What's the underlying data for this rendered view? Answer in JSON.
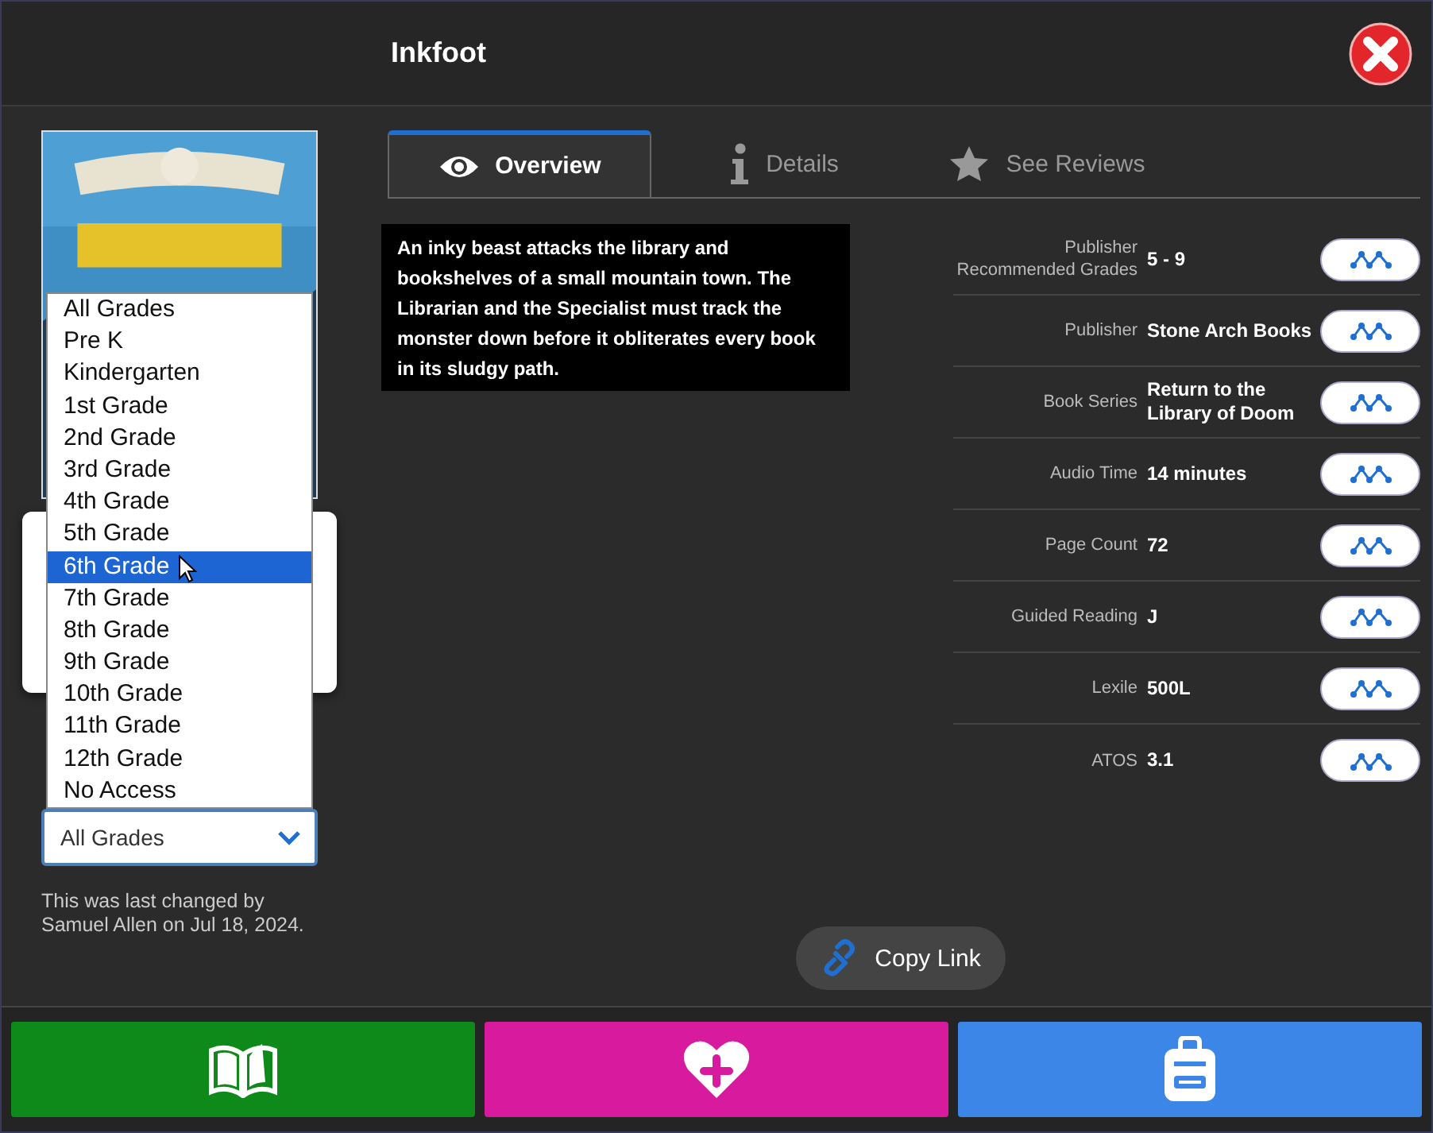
{
  "window": {
    "title": "Inkfoot"
  },
  "grade_dropdown": {
    "value": "All Grades",
    "options": [
      {
        "label": "All Grades",
        "highlighted": false
      },
      {
        "label": "Pre K",
        "highlighted": false
      },
      {
        "label": "Kindergarten",
        "highlighted": false
      },
      {
        "label": "1st Grade",
        "highlighted": false
      },
      {
        "label": "2nd Grade",
        "highlighted": false
      },
      {
        "label": "3rd Grade",
        "highlighted": false
      },
      {
        "label": "4th Grade",
        "highlighted": false
      },
      {
        "label": "5th Grade",
        "highlighted": false
      },
      {
        "label": "6th Grade",
        "highlighted": true
      },
      {
        "label": "7th Grade",
        "highlighted": false
      },
      {
        "label": "8th Grade",
        "highlighted": false
      },
      {
        "label": "9th Grade",
        "highlighted": false
      },
      {
        "label": "10th Grade",
        "highlighted": false
      },
      {
        "label": "11th Grade",
        "highlighted": false
      },
      {
        "label": "12th Grade",
        "highlighted": false
      },
      {
        "label": "No Access",
        "highlighted": false
      }
    ]
  },
  "change_note": "This was last changed by Samuel Allen on Jul 18, 2024.",
  "tabs": [
    {
      "label": "Overview",
      "selected": true,
      "kind": "eye"
    },
    {
      "label": "Details",
      "selected": false,
      "kind": "info"
    },
    {
      "label": "See Reviews",
      "selected": false,
      "kind": "star"
    }
  ],
  "description": "An inky beast attacks the library and bookshelves of a small mountain town. The Librarian and the Specialist must track the monster down before it obliterates every book in its sludgy path.",
  "details": [
    {
      "label": "Publisher Recommended Grades",
      "value": "5 - 9"
    },
    {
      "label": "Publisher",
      "value": "Stone Arch Books"
    },
    {
      "label": "Book Series",
      "value": "Return to the Library of Doom"
    },
    {
      "label": "Audio Time",
      "value": "14 minutes"
    },
    {
      "label": "Page Count",
      "value": "72"
    },
    {
      "label": "Guided Reading",
      "value": "J"
    },
    {
      "label": "Lexile",
      "value": "500L"
    },
    {
      "label": "ATOS",
      "value": "3.1"
    }
  ],
  "copy_link": "Copy Link",
  "actions": [
    {
      "kind": "read",
      "color": "#0e8a1a"
    },
    {
      "kind": "favorite",
      "color": "#d81b9e"
    },
    {
      "kind": "backpack",
      "color": "#3b86e6"
    }
  ]
}
